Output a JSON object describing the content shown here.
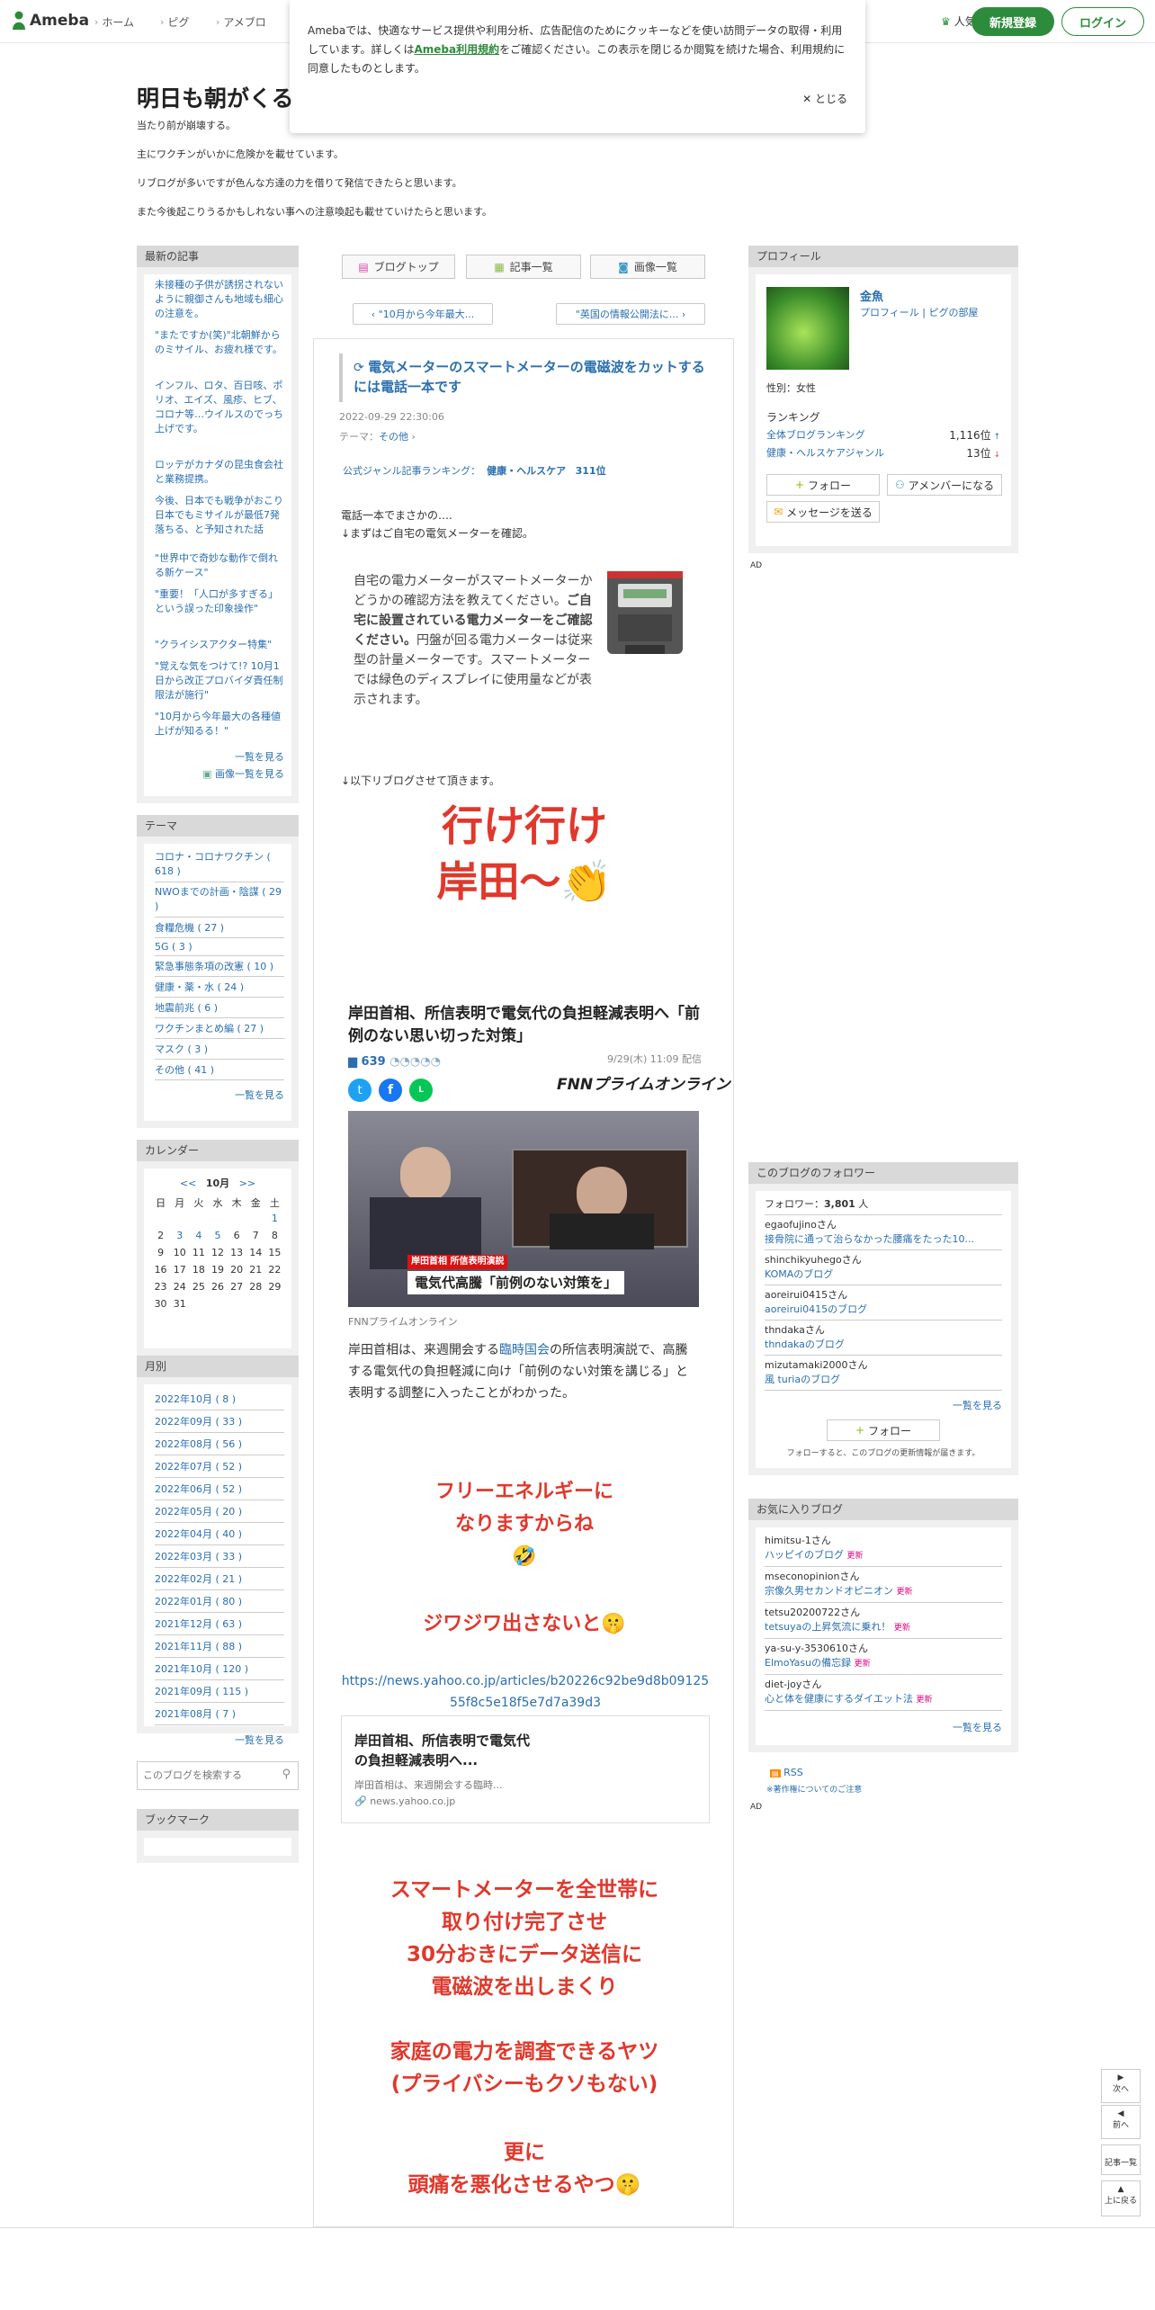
{
  "header": {
    "logo": "Ameba",
    "nav": [
      "ホーム",
      "ピグ",
      "アメブロ"
    ],
    "popular": "人気ブログ",
    "register": "新規登録",
    "login": "ログイン"
  },
  "cookie": {
    "text1": "Amebaでは、快適なサービス提供や利用分析、広告配信のためにクッキーなどを使い訪問データの取得・利用しています。詳しくは",
    "link": "Ameba利用規約",
    "text2": "をご確認ください。この表示を閉じるか閲覧を続けた場合、利用規約に同意したものとします。",
    "close": "とじる"
  },
  "blog": {
    "title": "明日も朝がくる",
    "desc": [
      "当たり前が崩壊する。",
      "主にワクチンがいかに危険かを載せています。",
      "リブログが多いですが色んな方達の力を借りて発信できたらと思います。",
      "また今後起こりうるかもしれない事への注意喚起も載せていけたらと思います。"
    ]
  },
  "left": {
    "recent_head": "最新の記事",
    "recent": [
      "未接種の子供が誘拐されないように親御さんも地域も細心の注意を。",
      "\"またですか(笑)\"北朝鮮からのミサイル、お疲れ様です。",
      "インフル、ロタ、百日咳、ポリオ、エイズ、風疹、ヒブ、コロナ等…ウイルスのでっち上げです。",
      "ロッテがカナダの昆虫食会社と業務提携。",
      "今後、日本でも戦争がおこり日本でもミサイルが最低7発落ちる、と予知された話",
      "\"世界中で奇妙な動作で倒れる新ケース\"",
      "\"重要！「人口が多すぎる」という誤った印象操作\"",
      "\"クライシスアクター特集\"",
      "\"覚えな気をつけて!? 10月1日から改正プロバイダ責任制限法が施行\"",
      "\"10月から今年最大の各種値上げが知るる！\""
    ],
    "recent_more": "一覧を見る",
    "image_more": "画像一覧を見る",
    "theme_head": "テーマ",
    "themes": [
      {
        "name": "コロナ・コロナワクチン",
        "count": "( 618 )"
      },
      {
        "name": "NWOまでの計画・陰謀",
        "count": "( 29 )"
      },
      {
        "name": "食糧危機",
        "count": "( 27 )"
      },
      {
        "name": "5G",
        "count": "( 3 )"
      },
      {
        "name": "緊急事態条項の改憲",
        "count": "( 10 )"
      },
      {
        "name": "健康・薬・水",
        "count": "( 24 )"
      },
      {
        "name": "地震前兆",
        "count": "( 6 )"
      },
      {
        "name": "ワクチンまとめ編",
        "count": "( 27 )"
      },
      {
        "name": "マスク",
        "count": "( 3 )"
      },
      {
        "name": "その他",
        "count": "( 41 )"
      }
    ],
    "theme_more": "一覧を見る",
    "calendar_head": "カレンダー",
    "cal_prev": "<<",
    "cal_month": "10月",
    "cal_next": ">>",
    "weekdays": [
      "日",
      "月",
      "火",
      "水",
      "木",
      "金",
      "土"
    ],
    "weeks": [
      [
        "",
        "",
        "",
        "",
        "",
        "",
        "1"
      ],
      [
        "2",
        "3",
        "4",
        "5",
        "6",
        "7",
        "8"
      ],
      [
        "9",
        "10",
        "11",
        "12",
        "13",
        "14",
        "15"
      ],
      [
        "16",
        "17",
        "18",
        "19",
        "20",
        "21",
        "22"
      ],
      [
        "23",
        "24",
        "25",
        "26",
        "27",
        "28",
        "29"
      ],
      [
        "30",
        "31",
        "",
        "",
        "",
        "",
        ""
      ]
    ],
    "monthly_head": "月別",
    "monthly": [
      "2022年10月 ( 8 )",
      "2022年09月 ( 33 )",
      "2022年08月 ( 56 )",
      "2022年07月 ( 52 )",
      "2022年06月 ( 52 )",
      "2022年05月 ( 20 )",
      "2022年04月 ( 40 )",
      "2022年03月 ( 33 )",
      "2022年02月 ( 21 )",
      "2022年01月 ( 80 )",
      "2021年12月 ( 63 )",
      "2021年11月 ( 88 )",
      "2021年10月 ( 120 )",
      "2021年09月 ( 115 )",
      "2021年08月 ( 7 )"
    ],
    "monthly_more": "一覧を見る",
    "search_placeholder": "このブログを検索する",
    "bookmark_head": "ブックマーク"
  },
  "main": {
    "top_btn": "ブログトップ",
    "list_btn": "記事一覧",
    "image_btn": "画像一覧",
    "prev": "\"10月から今年最大...",
    "next": "\"英国の情報公開法に...",
    "title": "電気メーターのスマートメーターの電磁波をカットするには電話一本です",
    "date": "2022-09-29 22:30:06",
    "theme_label": "テーマ：",
    "theme": "その他",
    "ranking_label": "公式ジャンル記事ランキング：",
    "ranking_genre": "健康・ヘルスケア",
    "ranking_pos": "311位",
    "body1": "電話一本でまさかの….",
    "body2": "↓まずはご自宅の電気メーターを確認。",
    "meter1": "自宅の電力メーターがスマートメーターかどうかの確認方法を教えてください。",
    "meter_bold": "ご自宅に設置されている電力メーターをご確認ください。",
    "meter2": "円盤が回る電力メーターは従来型の計量メーターです。スマートメーターでは緑色のディスプレイに使用量などが表示されます。",
    "reblog": "↓以下リブログさせて頂きます。",
    "big1": "行け行け",
    "big2": "岸田〜👏",
    "news_title": "岸田首相、所信表明で電気代の負担軽減表明へ「前例のない思い切った対策」",
    "comments": "639",
    "news_date": "9/29(木) 11:09 配信",
    "fnn": "FNNプライムオンライン",
    "caption": "岸田首相 所信表明演説",
    "banner": "電気代高騰「前例のない対策を」",
    "img_credit": "FNNプライムオンライン",
    "news_body_a": "岸田首相は、来週開会する",
    "news_link": "臨時国会",
    "news_body_b": "の所信表明演説で、高騰する電気代の負担軽減に向け「前例のない対策を講じる」と表明する調整に入ったことがわかった。",
    "red1": "フリーエネルギーに",
    "red2": "なりますからね",
    "red3": "🤣",
    "red4": "ジワジワ出さないと🤫",
    "url": "https://news.yahoo.co.jp/articles/b20226c92be9d8b0912555f8c5e18f5e7d7a39d3",
    "card_title": "岸田首相、所信表明で電気代の負担軽減表明へ...",
    "card_desc": "岸田首相は、来週開会する臨時...",
    "card_domain": "news.yahoo.co.jp",
    "red5": "スマートメーターを全世帯に",
    "red6": "取り付け完了させ",
    "red7": "30分おきにデータ送信に",
    "red8": "電磁波を出しまくり",
    "red9": "家庭の電力を調査できるヤツ",
    "red10": "(プライバシーもクソもない)",
    "red11": "更に",
    "red12": "頭痛を悪化させるやつ🤫"
  },
  "right": {
    "profile_head": "プロフィール",
    "name": "金魚",
    "profile_link": "プロフィール",
    "pig_link": "ピグの部屋",
    "gender": "性別：女性",
    "ranking_label": "ランキング",
    "rank1_name": "全体ブログランキング",
    "rank1_val": "1,116位",
    "rank2_name": "健康・ヘルスケアジャンル",
    "rank2_val": "13位",
    "follow": "フォロー",
    "member": "アメンバーになる",
    "message": "メッセージを送る",
    "ad": "AD",
    "followers_head": "このブログのフォロワー",
    "follower_label": "フォロワー：",
    "follower_count": "3,801",
    "follower_unit": "人",
    "followers": [
      {
        "user": "egaofujino",
        "blog": "接骨院に通って治らなかった腰痛をたった10..."
      },
      {
        "user": "shinchikyuhego",
        "blog": "KOMAのブログ"
      },
      {
        "user": "aoreirui0415",
        "blog": "aoreirui0415のブログ"
      },
      {
        "user": "thndaka",
        "blog": "thndakaのブログ"
      },
      {
        "user": "mizutamaki2000",
        "blog": "風 turiaのブログ"
      }
    ],
    "san": "さん",
    "followers_more": "一覧を見る",
    "follow2": "フォロー",
    "follow_note": "フォローすると、このブログの更新情報が届きます。",
    "fav_head": "お気に入りブログ",
    "favs": [
      {
        "user": "himitsu-1",
        "blog": "ハッピイのブログ"
      },
      {
        "user": "mseconopinion",
        "blog": "宗像久男セカンドオピニオン"
      },
      {
        "user": "tetsu20200722",
        "blog": "tetsuyaの上昇気流に乗れ！"
      },
      {
        "user": "ya-su-y-3530610",
        "blog": "ElmoYasuの備忘録"
      },
      {
        "user": "diet-joy",
        "blog": "心と体を健康にするダイエット法"
      }
    ],
    "updated": "更新",
    "fav_more": "一覧を見る",
    "rss": "RSS",
    "copyright": "※著作権についてのご注意",
    "ad2": "AD"
  },
  "sidenav": {
    "next": "次へ",
    "prev": "前へ",
    "list": "記事一覧",
    "top": "上に戻る"
  }
}
